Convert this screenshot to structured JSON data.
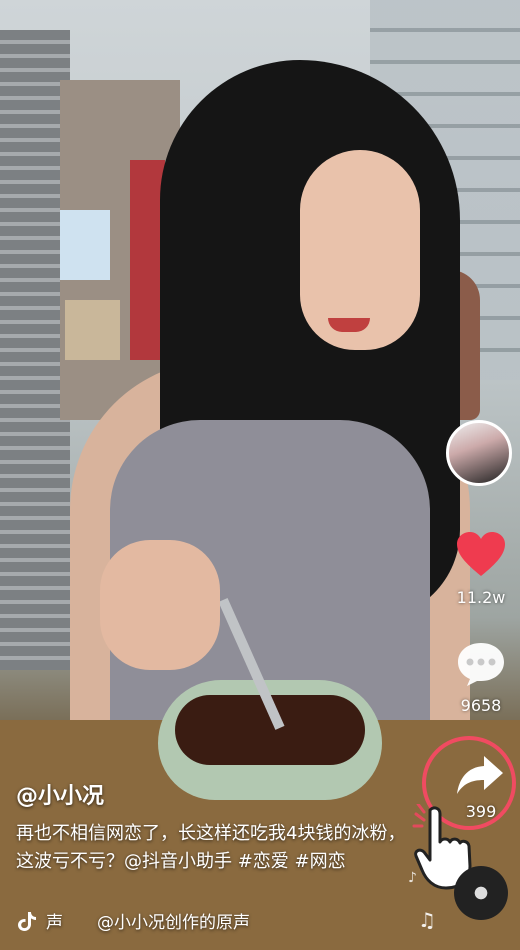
{
  "video": {
    "username": "@小小况",
    "caption": "再也不相信网恋了，长这样还吃我4块钱的冰粉，这波亏不亏？@抖音小助手 #恋爱 #网恋"
  },
  "actions": {
    "likes": "11.2w",
    "comments": "9658",
    "shares": "399",
    "accent_color": "#f04b61",
    "like_color": "#ef3b4f"
  },
  "music": {
    "label_fragment": "声",
    "creator": "@小小况创作的原声"
  }
}
